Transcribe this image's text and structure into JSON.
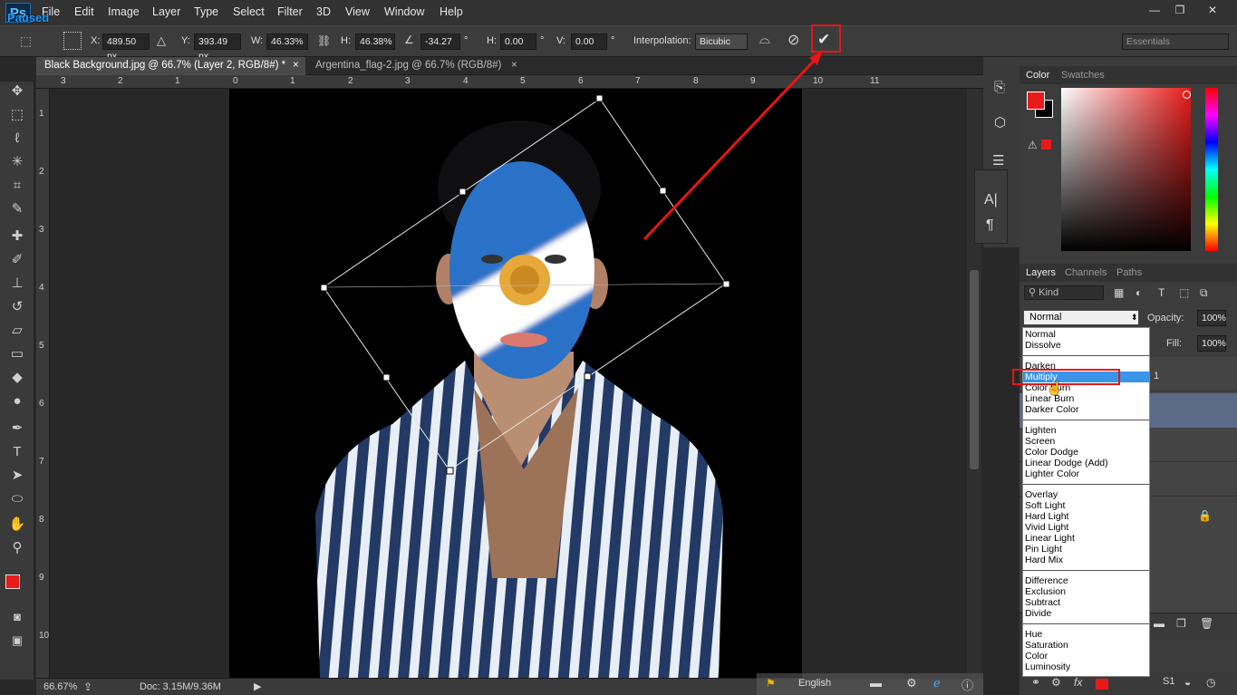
{
  "app": {
    "logo": "Ps",
    "overlay": "Paused"
  },
  "menu": [
    "File",
    "Edit",
    "Image",
    "Layer",
    "Type",
    "Select",
    "Filter",
    "3D",
    "View",
    "Window",
    "Help"
  ],
  "window_buttons": {
    "minimize": "—",
    "restore": "❐",
    "close": "✕"
  },
  "options": {
    "x_label": "X:",
    "x_value": "489.50 px",
    "y_label": "Y:",
    "y_value": "393.49 px",
    "w_label": "W:",
    "w_value": "46.33%",
    "h_label": "H:",
    "h_value": "46.38%",
    "angle_value": "-34.27",
    "deg": "°",
    "hskew_label": "H:",
    "hskew_value": "0.00",
    "vskew_label": "V:",
    "vskew_value": "0.00",
    "interp_label": "Interpolation:",
    "interp_value": "Bicubic",
    "workspace": "Essentials"
  },
  "tabs": [
    {
      "label": "Black Background.jpg @ 66.7% (Layer 2, RGB/8#) *",
      "close": "×"
    },
    {
      "label": "Argentina_flag-2.jpg @ 66.7% (RGB/8#)",
      "close": "×"
    }
  ],
  "ruler_top": [
    "3",
    "2",
    "1",
    "0",
    "1",
    "2",
    "3",
    "4",
    "5",
    "6",
    "7",
    "8",
    "9",
    "10",
    "11"
  ],
  "ruler_left": [
    "1",
    "2",
    "3",
    "4",
    "5",
    "6",
    "7",
    "8",
    "9",
    "10"
  ],
  "status": {
    "zoom": "66.67%",
    "doc": "Doc: 3.15M/9.36M"
  },
  "taskbar": {
    "lang": "English"
  },
  "panels": {
    "color_tab": "Color",
    "swatches_tab": "Swatches",
    "layers_tab": "Layers",
    "channels_tab": "Channels",
    "paths_tab": "Paths",
    "kind": "Kind",
    "blend_value": "Normal",
    "opacity_label": "Opacity:",
    "opacity_value": "100%",
    "fill_label": "Fill:",
    "fill_value": "100%",
    "layer_num": "1"
  },
  "blend_groups": [
    [
      "Normal",
      "Dissolve"
    ],
    [
      "Darken",
      "Multiply",
      "Color Burn",
      "Linear Burn",
      "Darker Color"
    ],
    [
      "Lighten",
      "Screen",
      "Color Dodge",
      "Linear Dodge (Add)",
      "Lighter Color"
    ],
    [
      "Overlay",
      "Soft Light",
      "Hard Light",
      "Vivid Light",
      "Linear Light",
      "Pin Light",
      "Hard Mix"
    ],
    [
      "Difference",
      "Exclusion",
      "Subtract",
      "Divide"
    ],
    [
      "Hue",
      "Saturation",
      "Color",
      "Luminosity"
    ]
  ],
  "blend_selected": "Multiply",
  "colors": {
    "foreground": "#e81a1a",
    "background": "#000000",
    "accent_red": "#e81515",
    "flag_blue": "#2a72c8",
    "selected_blue": "#3a94e8"
  }
}
